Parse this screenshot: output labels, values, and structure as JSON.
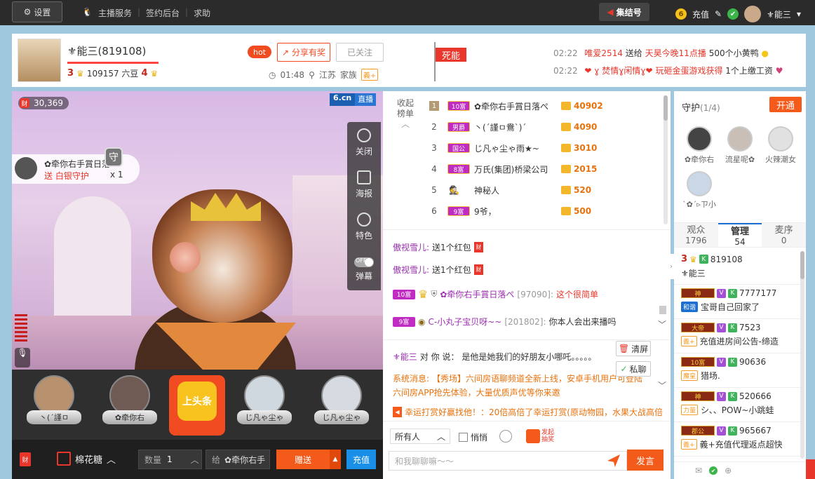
{
  "topbar": {
    "settings": "设置",
    "links": [
      "主播服务",
      "签约后台",
      "求助"
    ],
    "jijie": "集结号",
    "recharge": "充值",
    "user": "⚜能三"
  },
  "header": {
    "name": "⚜能三(819108)",
    "level_left": "3",
    "bean_count": "109157 六豆",
    "level_right": "4",
    "hot": "hot",
    "share": "分享有奖",
    "follow": "已关注",
    "time": "01:48",
    "location": "江苏",
    "family_label": "家族",
    "family_badge": "義+",
    "flag": "死能",
    "broadcasts": [
      {
        "time": "02:22",
        "text_a": "唯爱2514",
        "text_b": "送给",
        "text_c": "天昊今晚11点播",
        "text_d": "500个小黄鸭"
      },
      {
        "time": "02:22",
        "text_a": "❤ ɣ 焚情ɣ闲情ɣ❤",
        "text_b": "玩砸金蛋游戏获得",
        "text_c": "",
        "text_d": "1个上缴工资"
      }
    ]
  },
  "video": {
    "fans": "30,369",
    "logo_a": "6.cn",
    "logo_b": "直播",
    "guard_tip": {
      "name": "✿牵你右手賞日落ぺ",
      "desc": "送 白银守护",
      "count": "x 1",
      "badge": "守"
    },
    "controls": [
      "关闭",
      "海报",
      "特色",
      "弹幕"
    ],
    "toggle": "OFF"
  },
  "gifts": {
    "items": [
      "丶(ˊ謹ㅁ",
      "✿牵你右",
      "上头条",
      "じ凡ゃ尘ゃ",
      "じ凡ゃ尘ゃ"
    ],
    "hot_label": "上头条"
  },
  "bottombar": {
    "cai": "财",
    "gift_name": "棉花糖",
    "qty_label": "数量",
    "qty_value": "1",
    "to_label": "给",
    "to_value": "✿牵你右手",
    "send": "赠送",
    "recharge": "充值"
  },
  "rank": {
    "toggle_1": "收起",
    "toggle_2": "榜单",
    "rows": [
      {
        "no": "1",
        "badge": "10富",
        "name": "✿牵你右手賞日落ぺ",
        "value": "40902"
      },
      {
        "no": "2",
        "badge": "男爵",
        "name": "丶(ˊ謹ㅁ鴦ˋ)ˊ",
        "value": "4090"
      },
      {
        "no": "3",
        "badge": "国公",
        "name": "じ凡ゃ尘ゃ雨★~",
        "value": "3010"
      },
      {
        "no": "4",
        "badge": "8富",
        "name": "万氏(集团)桥梁公司",
        "value": "2015"
      },
      {
        "no": "5",
        "badge": "",
        "name": "神秘人",
        "value": "520"
      },
      {
        "no": "6",
        "badge": "9富",
        "name": "9爷，",
        "value": "500"
      }
    ]
  },
  "chat": {
    "lines": [
      {
        "user": "傲视雪儿:",
        "text": "送1个红包"
      },
      {
        "user": "傲视雪儿:",
        "text": "送1个红包"
      },
      {
        "badge": "10富",
        "user": "✿牵你右手賞日落ぺ",
        "id": "[97090]:",
        "text": "这个很简单"
      },
      {
        "badge": "9富",
        "user": "C-小丸子宝贝呀~~",
        "id": "[201802]:",
        "text": "你本人会出来播吗"
      }
    ]
  },
  "sys": {
    "pm_user": "⚜能三",
    "pm_mid": "对 你 说：",
    "pm_text": "是他是她我们的好朋友小哪吒。。。。。",
    "clear": "清屏",
    "private": "私聊",
    "notice_label": "系统消息:",
    "notice_1": "【秀场】六间房语聊频道全新上线，安卓手机用户可登陆",
    "notice_2": "六间房APP抢先体验，大量优质声优等你来邀",
    "ad": "幸运打赏好赢找他！：20倍高倍了幸运打赏(原动物园，水果大战高倍"
  },
  "input": {
    "target": "所有人",
    "whisper": "悄悄",
    "fred_1": "发起",
    "fred_2": "抽奖",
    "placeholder": "和我聊聊嘛～～",
    "send": "发言"
  },
  "right": {
    "guard_title": "守护",
    "guard_count": "(1/4)",
    "open": "开通",
    "guards": [
      "✿牵你右",
      "流星呢✿",
      "火辣潮女",
      "ˋ✿ˊ▹ㄗ小"
    ],
    "tabs": [
      {
        "label": "观众",
        "count": "1796"
      },
      {
        "label": "管理",
        "count": "54"
      },
      {
        "label": "麦序",
        "count": "0"
      }
    ],
    "admins": [
      {
        "lvl": "3",
        "gd": "",
        "v": false,
        "id": "819108",
        "name": "⚜能三",
        "fam": ""
      },
      {
        "lvl": "",
        "gd": "神",
        "v": true,
        "id": "7777177",
        "name": "宝哥自己回家了",
        "fam": "和谐"
      },
      {
        "lvl": "",
        "gd": "大帝",
        "v": true,
        "id": "7523",
        "name": "充值进房间公告-缔造",
        "fam": "義+"
      },
      {
        "lvl": "",
        "gd": "10富",
        "v": true,
        "id": "90636",
        "name": "猎场.",
        "fam": "魔皇"
      },
      {
        "lvl": "",
        "gd": "神",
        "v": true,
        "id": "520666",
        "name": "シ、、POW~小跳蛙",
        "fam": "力量"
      },
      {
        "lvl": "",
        "gd": "郡公",
        "v": true,
        "id": "965667",
        "name": "義+充值代理返点超快",
        "fam": "義+"
      }
    ]
  }
}
